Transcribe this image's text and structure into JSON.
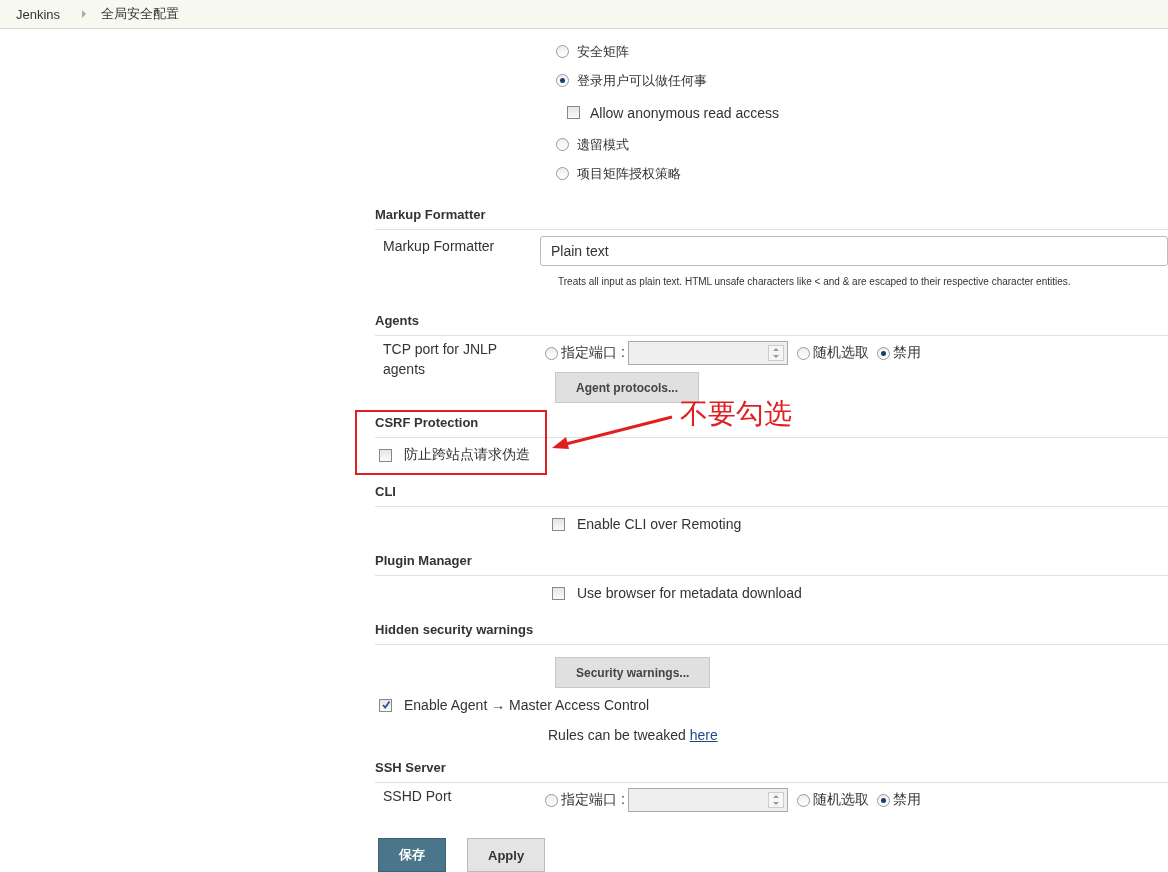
{
  "breadcrumb": [
    {
      "label": "Jenkins"
    },
    {
      "label": "全局安全配置"
    }
  ],
  "authorization": {
    "options": [
      {
        "label": "安全矩阵",
        "selected": false
      },
      {
        "label": "登录用户可以做任何事",
        "selected": true,
        "sub_option": {
          "label": "Allow anonymous read access",
          "checked": false
        }
      },
      {
        "label": "遗留模式",
        "selected": false
      },
      {
        "label": "项目矩阵授权策略",
        "selected": false
      }
    ]
  },
  "sections": [
    {
      "title": "Markup Formatter",
      "rows": [
        {
          "kind": "select",
          "label": "Markup Formatter",
          "value": "Plain text",
          "description": "Treats all input as plain text. HTML unsafe characters like < and & are escaped to their respective character entities."
        }
      ]
    },
    {
      "title": "Agents",
      "rows": [
        {
          "kind": "port",
          "label": "TCP port for JNLP agents",
          "options": [
            {
              "label": "指定端口 :",
              "selected": false
            },
            {
              "label": "随机选取",
              "selected": false
            },
            {
              "label": "禁用",
              "selected": true
            }
          ]
        },
        {
          "kind": "button",
          "label": "Agent protocols..."
        }
      ]
    },
    {
      "title": "CSRF Protection",
      "annotation": {
        "text": "不要勾选"
      },
      "rows": [
        {
          "kind": "block-checkbox",
          "label": "防止跨站点请求伪造",
          "checked": false
        }
      ]
    },
    {
      "title": "CLI",
      "rows": [
        {
          "kind": "checkbox",
          "label": "Enable CLI over Remoting",
          "checked": false
        }
      ]
    },
    {
      "title": "Plugin Manager",
      "rows": [
        {
          "kind": "checkbox",
          "label": "Use browser for metadata download",
          "checked": false
        }
      ]
    },
    {
      "title": "Hidden security warnings",
      "rows": [
        {
          "kind": "button",
          "label": "Security warnings..."
        },
        {
          "kind": "block-checkbox",
          "label": "Enable Agent → Master Access Control",
          "checked": true
        },
        {
          "kind": "note",
          "text": "Rules can be tweaked ",
          "link": "here"
        }
      ]
    },
    {
      "title": "SSH Server",
      "rows": [
        {
          "kind": "port",
          "label": "SSHD Port",
          "options": [
            {
              "label": "指定端口 :",
              "selected": false
            },
            {
              "label": "随机选取",
              "selected": false
            },
            {
              "label": "禁用",
              "selected": true
            }
          ]
        }
      ]
    }
  ],
  "form_buttons": [
    {
      "label": "保存",
      "kind": "primary"
    },
    {
      "label": "Apply",
      "kind": "secondary"
    }
  ]
}
